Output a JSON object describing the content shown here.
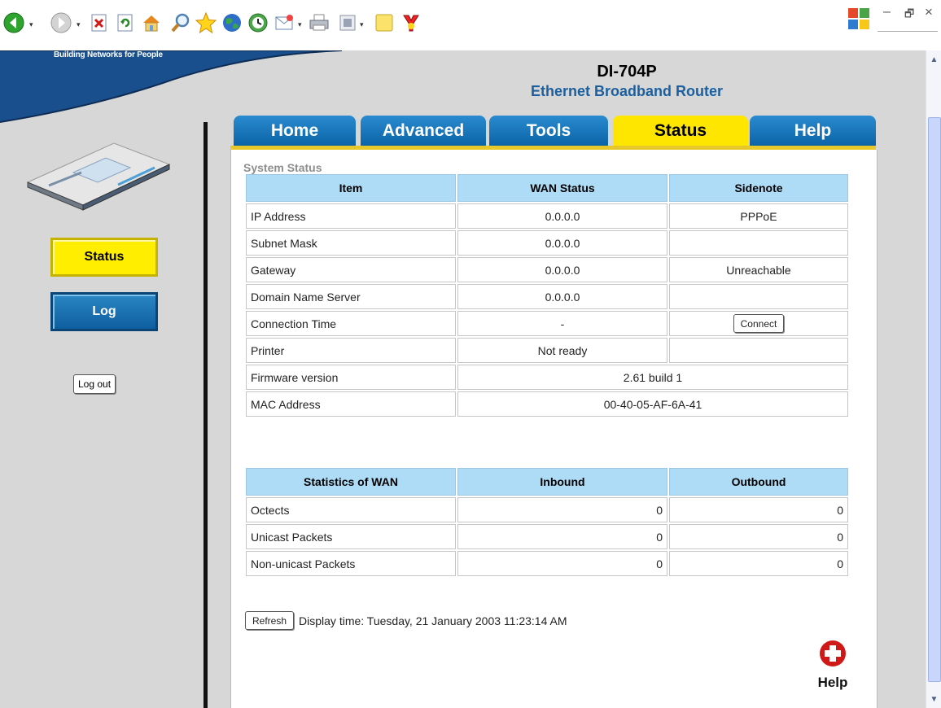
{
  "browser": {
    "toolbar_icons": [
      "back-icon",
      "forward-icon",
      "stop-icon",
      "refresh-icon",
      "home-icon",
      "search-icon",
      "favorites-icon",
      "media-icon",
      "history-icon",
      "mail-icon",
      "print-icon",
      "edit-icon",
      "notes-icon",
      "messenger-icon"
    ],
    "window_controls": {
      "minimize": "–",
      "restore": "🗗",
      "close": "×"
    }
  },
  "header": {
    "tagline": "Building Networks for People",
    "model_name": "DI-704P",
    "model_desc": "Ethernet Broadband Router"
  },
  "tabs": [
    {
      "label": "Home",
      "active": false
    },
    {
      "label": "Advanced",
      "active": false
    },
    {
      "label": "Tools",
      "active": false
    },
    {
      "label": "Status",
      "active": true
    },
    {
      "label": "Help",
      "active": false
    }
  ],
  "sidebar": {
    "status_label": "Status",
    "log_label": "Log",
    "logout_label": "Log out"
  },
  "main": {
    "section_title": "System Status",
    "status_table": {
      "headers": [
        "Item",
        "WAN Status",
        "Sidenote"
      ],
      "rows": [
        {
          "item": "IP Address",
          "value": "0.0.0.0",
          "note": "PPPoE"
        },
        {
          "item": "Subnet Mask",
          "value": "0.0.0.0",
          "note": ""
        },
        {
          "item": "Gateway",
          "value": "0.0.0.0",
          "note": "Unreachable"
        },
        {
          "item": "Domain Name Server",
          "value": "0.0.0.0",
          "note": ""
        },
        {
          "item": "Connection Time",
          "value": "-",
          "button": "Connect"
        },
        {
          "item": "Printer",
          "value": "Not ready",
          "note": ""
        },
        {
          "item": "Firmware version",
          "value": "2.61 build 1"
        },
        {
          "item": "MAC Address",
          "value": "00-40-05-AF-6A-41"
        }
      ]
    },
    "wan_table": {
      "headers": [
        "Statistics of WAN",
        "Inbound",
        "Outbound"
      ],
      "rows": [
        {
          "item": "Octects",
          "inbound": "0",
          "outbound": "0"
        },
        {
          "item": "Unicast Packets",
          "inbound": "0",
          "outbound": "0"
        },
        {
          "item": "Non-unicast Packets",
          "inbound": "0",
          "outbound": "0"
        }
      ]
    },
    "refresh_label": "Refresh",
    "display_time": "Display time: Tuesday, 21 January 2003 11:23:14 AM",
    "help_label": "Help"
  },
  "colors": {
    "tab_blue": "#0b63a6",
    "tab_active": "#ffe600",
    "header_blue": "#1c5f9e",
    "table_header": "#aedcf6"
  }
}
